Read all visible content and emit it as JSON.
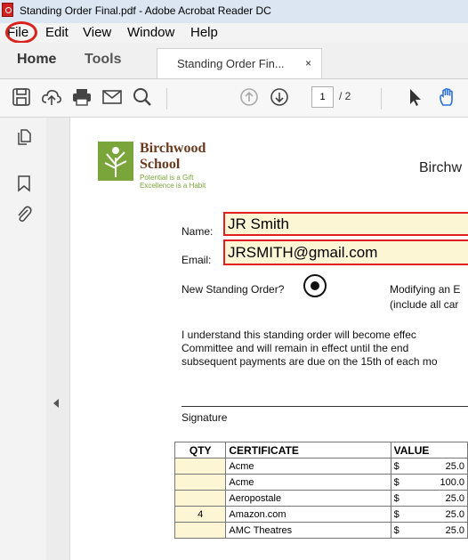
{
  "window": {
    "title": "Standing Order Final.pdf - Adobe Acrobat Reader DC"
  },
  "menu": [
    "File",
    "Edit",
    "View",
    "Window",
    "Help"
  ],
  "tabs": {
    "home": "Home",
    "tools": "Tools",
    "document": "Standing Order Fin...",
    "close": "×"
  },
  "toolbar": {
    "page_current": "1",
    "page_total": "/ 2"
  },
  "document": {
    "school_name_line1": "Birchwood",
    "school_name_line2": "School",
    "motto_line1": "Potential is a Gift",
    "motto_line2": "Excellence is a Habit",
    "header_title": "Birchw",
    "name_label": "Name:",
    "name_value": "JR Smith",
    "email_label": "Email:",
    "email_value": "JRSMITH@gmail.com",
    "new_order_label": "New Standing Order?",
    "modify_label_line1": "Modifying an E",
    "modify_label_line2": "(include all car",
    "paragraph_line1": "I understand this standing order will become effec",
    "paragraph_line2": "Committee and will remain in effect until the end",
    "paragraph_line3": "subsequent payments are due on the 15th of each mo",
    "signature_label": "Signature",
    "table": {
      "headers": [
        "QTY",
        "CERTIFICATE",
        "VALUE"
      ],
      "rows": [
        {
          "qty": "",
          "certificate": "Acme",
          "currency": "$",
          "value": "25.0"
        },
        {
          "qty": "",
          "certificate": "Acme",
          "currency": "$",
          "value": "100.0"
        },
        {
          "qty": "",
          "certificate": "Aeropostale",
          "currency": "$",
          "value": "25.0"
        },
        {
          "qty": "4",
          "certificate": "Amazon.com",
          "currency": "$",
          "value": "25.0"
        },
        {
          "qty": "",
          "certificate": "AMC Theatres",
          "currency": "$",
          "value": "25.0"
        }
      ]
    }
  },
  "colors": {
    "highlight_circle": "#d8221c",
    "field_fill": "#fdf6d5",
    "field_border": "#e02020",
    "hand_tool": "#2b6fd6",
    "logo_green": "#7aa53a",
    "logo_brown": "#6b3a1e"
  }
}
